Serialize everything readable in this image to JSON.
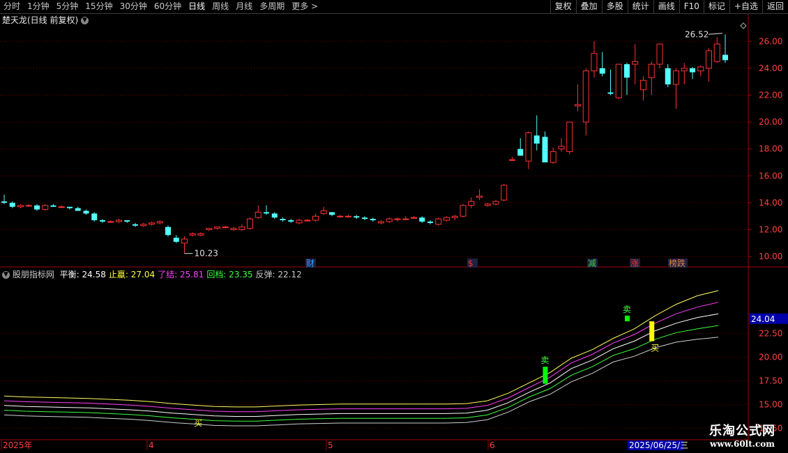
{
  "toolbar": {
    "left": [
      "分时",
      "1分钟",
      "5分钟",
      "15分钟",
      "30分钟",
      "60分钟",
      "日线",
      "周线",
      "月线",
      "多周期",
      "更多 >"
    ],
    "active": "日线",
    "right": [
      "复权",
      "叠加",
      "多股",
      "统计",
      "画线",
      "F10",
      "标记",
      "+自选",
      "返回"
    ]
  },
  "main_panel": {
    "title": "楚天龙(日线 前复权)",
    "high_label": "26.52",
    "low_label": "10.23",
    "y_ticks": [
      "26.00",
      "24.00",
      "22.00",
      "20.00",
      "18.00",
      "16.00",
      "14.00",
      "12.00",
      "10.00"
    ],
    "event_markers": [
      {
        "text": "财",
        "color": "#2aa3ff"
      },
      {
        "text": "$",
        "color": "#ff3030"
      },
      {
        "text": "减",
        "color": "#40d040"
      },
      {
        "text": "涨",
        "color": "#ff3030"
      },
      {
        "text": "榜跌",
        "color": "#e08040"
      }
    ]
  },
  "indicator_panel": {
    "name": "股朋指标网",
    "items": [
      {
        "label": "平衡:",
        "value": "24.58",
        "color": "#ffffff"
      },
      {
        "label": "止蠃:",
        "value": "27.04",
        "color": "#ffff40"
      },
      {
        "label": "了结:",
        "value": "25.81",
        "color": "#ff40ff"
      },
      {
        "label": "回档:",
        "value": "23.35",
        "color": "#40ff40"
      },
      {
        "label": "反弹:",
        "value": "22.12",
        "color": "#c8c8c8"
      }
    ],
    "y_ticks": [
      "22.50",
      "20.00",
      "17.50",
      "15.00",
      "12.50"
    ],
    "current_value_tag": "24.04",
    "sell_label": "卖",
    "buy_label": "买"
  },
  "date_axis": {
    "labels": [
      "2025年",
      "4",
      "5",
      "6"
    ],
    "cursor_date": "2025/06/25/三"
  },
  "watermark": {
    "line1": "乐淘公式网",
    "line2": "www.60lt.com"
  },
  "chart_data": {
    "type": "candlestick",
    "title": "楚天龙(日线 前复权)",
    "y_range": [
      9.8,
      27.0
    ],
    "up_color": "#ff3232",
    "down_color": "#54ffff",
    "candles": [
      [
        14.1,
        14.6,
        13.9,
        14.0
      ],
      [
        14.0,
        14.1,
        13.6,
        13.7
      ],
      [
        13.7,
        13.9,
        13.6,
        13.8
      ],
      [
        13.8,
        13.9,
        13.7,
        13.8
      ],
      [
        13.8,
        13.9,
        13.4,
        13.5
      ],
      [
        13.5,
        13.9,
        13.4,
        13.8
      ],
      [
        13.8,
        13.9,
        13.7,
        13.7
      ],
      [
        13.7,
        13.8,
        13.6,
        13.7
      ],
      [
        13.7,
        13.7,
        13.5,
        13.6
      ],
      [
        13.6,
        13.7,
        13.4,
        13.4
      ],
      [
        13.4,
        13.5,
        13.1,
        13.2
      ],
      [
        13.2,
        13.3,
        12.6,
        12.7
      ],
      [
        12.7,
        12.8,
        12.5,
        12.6
      ],
      [
        12.6,
        12.7,
        12.5,
        12.6
      ],
      [
        12.6,
        12.8,
        12.5,
        12.7
      ],
      [
        12.7,
        12.7,
        12.5,
        12.6
      ],
      [
        12.4,
        12.5,
        12.2,
        12.3
      ],
      [
        12.3,
        12.5,
        12.2,
        12.4
      ],
      [
        12.4,
        12.6,
        12.3,
        12.5
      ],
      [
        12.5,
        12.7,
        12.4,
        12.6
      ],
      [
        12.2,
        12.3,
        11.5,
        11.6
      ],
      [
        11.4,
        11.6,
        11.0,
        11.1
      ],
      [
        11.0,
        11.5,
        10.23,
        11.3
      ],
      [
        11.6,
        11.8,
        11.5,
        11.7
      ],
      [
        11.6,
        11.8,
        11.5,
        11.7
      ],
      [
        12.0,
        12.1,
        11.9,
        12.1
      ],
      [
        12.1,
        12.2,
        12.0,
        12.2
      ],
      [
        12.2,
        12.3,
        12.1,
        12.2
      ],
      [
        12.0,
        12.2,
        11.9,
        12.1
      ],
      [
        12.0,
        12.4,
        11.9,
        12.2
      ],
      [
        12.1,
        12.9,
        12.0,
        12.8
      ],
      [
        12.9,
        13.8,
        12.8,
        13.3
      ],
      [
        13.3,
        13.8,
        13.1,
        13.2
      ],
      [
        13.2,
        13.3,
        12.8,
        12.9
      ],
      [
        12.8,
        12.9,
        12.6,
        12.7
      ],
      [
        12.7,
        12.8,
        12.5,
        12.6
      ],
      [
        12.5,
        12.8,
        12.4,
        12.7
      ],
      [
        12.7,
        12.8,
        12.6,
        12.7
      ],
      [
        12.7,
        13.2,
        12.6,
        13.0
      ],
      [
        13.2,
        13.7,
        13.1,
        13.4
      ],
      [
        13.3,
        13.3,
        13.0,
        13.1
      ],
      [
        13.0,
        13.1,
        12.9,
        13.0
      ],
      [
        13.0,
        13.1,
        12.9,
        13.0
      ],
      [
        13.0,
        13.1,
        12.8,
        12.9
      ],
      [
        12.9,
        13.0,
        12.7,
        12.8
      ],
      [
        12.8,
        12.9,
        12.6,
        12.7
      ],
      [
        12.5,
        12.7,
        12.4,
        12.6
      ],
      [
        12.6,
        12.9,
        12.5,
        12.8
      ],
      [
        12.8,
        12.9,
        12.6,
        12.8
      ],
      [
        12.8,
        13.0,
        12.7,
        12.8
      ],
      [
        12.9,
        13.0,
        12.8,
        12.9
      ],
      [
        12.9,
        13.0,
        12.5,
        12.6
      ],
      [
        12.6,
        12.7,
        12.4,
        12.5
      ],
      [
        12.4,
        12.9,
        12.3,
        12.8
      ],
      [
        12.7,
        13.0,
        12.6,
        12.9
      ],
      [
        12.9,
        13.1,
        12.7,
        13.0
      ],
      [
        13.0,
        13.9,
        12.9,
        13.8
      ],
      [
        13.8,
        14.4,
        13.6,
        14.1
      ],
      [
        14.4,
        15.0,
        14.2,
        14.5
      ],
      [
        13.8,
        14.0,
        13.7,
        13.9
      ],
      [
        13.9,
        14.2,
        13.8,
        14.1
      ],
      [
        14.2,
        15.4,
        14.1,
        15.3
      ],
      [
        17.2,
        17.4,
        17.1,
        17.2
      ],
      [
        18.0,
        18.8,
        17.6,
        17.5
      ],
      [
        17.1,
        19.3,
        16.5,
        19.2
      ],
      [
        19.0,
        20.5,
        17.9,
        18.4
      ],
      [
        18.9,
        19.3,
        17.0,
        17.0
      ],
      [
        17.0,
        18.1,
        16.9,
        17.8
      ],
      [
        18.0,
        18.8,
        17.8,
        18.2
      ],
      [
        17.8,
        20.0,
        17.6,
        20.0
      ],
      [
        21.2,
        22.8,
        20.8,
        21.3
      ],
      [
        20.0,
        24.0,
        19.0,
        23.8
      ],
      [
        23.8,
        26.0,
        23.3,
        25.1
      ],
      [
        24.0,
        25.2,
        23.4,
        23.6
      ],
      [
        22.2,
        23.9,
        22.0,
        22.1
      ],
      [
        21.8,
        24.3,
        21.7,
        24.3
      ],
      [
        24.3,
        24.4,
        22.0,
        23.3
      ],
      [
        24.3,
        25.8,
        22.8,
        24.5
      ],
      [
        22.4,
        23.4,
        21.6,
        23.1
      ],
      [
        23.3,
        24.5,
        22.0,
        24.3
      ],
      [
        24.3,
        25.8,
        24.0,
        25.8
      ],
      [
        24.0,
        24.3,
        22.6,
        22.8
      ],
      [
        22.8,
        24.0,
        21.0,
        23.8
      ],
      [
        23.8,
        24.4,
        22.8,
        24.0
      ],
      [
        24.0,
        24.1,
        23.2,
        23.7
      ],
      [
        23.8,
        24.2,
        23.4,
        24.1
      ],
      [
        24.0,
        25.5,
        23.0,
        25.3
      ],
      [
        24.5,
        26.3,
        24.4,
        25.8
      ],
      [
        25.0,
        26.52,
        24.4,
        24.6
      ]
    ],
    "indicator": {
      "series": [
        {
          "name": "止蠃",
          "color": "#ffff60",
          "values": [
            15.9,
            15.8,
            15.75,
            15.7,
            15.65,
            15.55,
            15.45,
            15.3,
            15.1,
            14.95,
            14.8,
            14.75,
            14.75,
            14.85,
            14.95,
            15.0,
            15.05,
            15.05,
            15.05,
            15.05,
            15.05,
            15.05,
            15.1,
            15.4,
            16.2,
            17.3,
            18.4,
            19.9,
            20.8,
            22.0,
            23.0,
            24.4,
            25.6,
            26.5,
            27.04
          ]
        },
        {
          "name": "了结",
          "color": "#ff40ff",
          "values": [
            15.4,
            15.3,
            15.25,
            15.2,
            15.15,
            15.05,
            14.95,
            14.8,
            14.6,
            14.45,
            14.3,
            14.25,
            14.25,
            14.35,
            14.45,
            14.5,
            14.55,
            14.55,
            14.55,
            14.55,
            14.55,
            14.55,
            14.6,
            14.9,
            15.7,
            16.8,
            17.9,
            19.4,
            20.3,
            21.5,
            22.4,
            23.6,
            24.6,
            25.3,
            25.81
          ]
        },
        {
          "name": "平衡",
          "color": "#ffffff",
          "values": [
            14.9,
            14.8,
            14.75,
            14.7,
            14.65,
            14.55,
            14.45,
            14.3,
            14.1,
            13.95,
            13.8,
            13.75,
            13.75,
            13.85,
            13.95,
            14.0,
            14.05,
            14.05,
            14.05,
            14.05,
            14.05,
            14.05,
            14.1,
            14.4,
            15.2,
            16.3,
            17.3,
            18.8,
            19.7,
            20.9,
            21.7,
            22.8,
            23.6,
            24.2,
            24.58
          ]
        },
        {
          "name": "回档",
          "color": "#40ff40",
          "values": [
            14.4,
            14.3,
            14.25,
            14.2,
            14.15,
            14.05,
            13.95,
            13.8,
            13.6,
            13.45,
            13.3,
            13.25,
            13.25,
            13.35,
            13.45,
            13.5,
            13.55,
            13.55,
            13.55,
            13.55,
            13.55,
            13.55,
            13.6,
            13.9,
            14.7,
            15.8,
            16.7,
            18.1,
            19.0,
            20.2,
            20.9,
            21.9,
            22.6,
            23.0,
            23.35
          ]
        },
        {
          "name": "反弹",
          "color": "#d0d0d0",
          "values": [
            13.9,
            13.8,
            13.75,
            13.7,
            13.65,
            13.55,
            13.45,
            13.3,
            13.1,
            12.95,
            12.8,
            12.75,
            12.75,
            12.85,
            12.95,
            13.0,
            13.05,
            13.05,
            13.05,
            13.05,
            13.05,
            13.05,
            13.1,
            13.4,
            14.2,
            15.3,
            16.1,
            17.4,
            18.3,
            19.5,
            20.1,
            21.0,
            21.6,
            21.9,
            22.12
          ]
        }
      ],
      "y_range": [
        11.5,
        28.0
      ],
      "signals": [
        {
          "type": "sell",
          "candle": 66,
          "from": 17.2,
          "to": 19.0,
          "color": "#00ff00"
        },
        {
          "type": "sell",
          "candle": 76,
          "from": 23.8,
          "to": 24.4,
          "color": "#00ff00"
        },
        {
          "type": "buy",
          "candle": 79,
          "from": 21.7,
          "to": 23.8,
          "color": "#ffff00"
        }
      ],
      "buy_low_candle": 23
    }
  }
}
